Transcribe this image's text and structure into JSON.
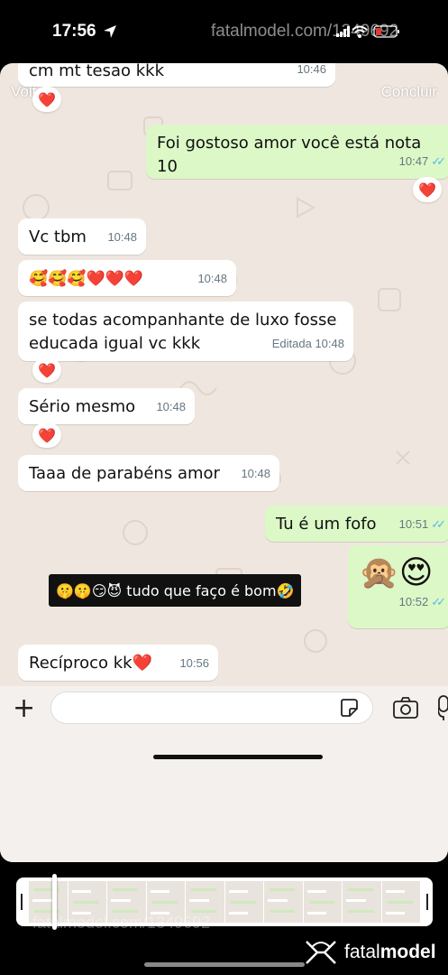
{
  "status": {
    "time": "17:56",
    "watermark": "fatalmodel.com/1349692"
  },
  "nav": {
    "back_label": "Voltar",
    "done_label": "Concluir"
  },
  "messages": [
    {
      "id": "m0",
      "dir": "in",
      "text": "cm mt tesao kkk",
      "time": "10:46",
      "reaction": "❤️"
    },
    {
      "id": "m1",
      "dir": "out",
      "text": "Foi gostoso amor você está nota 10",
      "time": "10:47",
      "reaction": "❤️"
    },
    {
      "id": "m2",
      "dir": "in",
      "text": "Vc tbm",
      "time": "10:48"
    },
    {
      "id": "m3",
      "dir": "in",
      "text": "🥰🥰🥰❤️❤️❤️",
      "time": "10:48"
    },
    {
      "id": "m4",
      "dir": "in",
      "text": "se todas acompanhante de luxo fosse educada igual vc kkk",
      "time": "10:48",
      "edited_label": "Editada",
      "reaction": "❤️"
    },
    {
      "id": "m5",
      "dir": "in",
      "text": "Sério mesmo",
      "time": "10:48",
      "reaction": "❤️"
    },
    {
      "id": "m6",
      "dir": "in",
      "text": "Taaa de parabéns amor",
      "time": "10:48"
    },
    {
      "id": "m7",
      "dir": "out",
      "text": "Tu é um fofo",
      "time": "10:51"
    },
    {
      "id": "m8",
      "dir": "out",
      "text": "🙊😍",
      "time": "10:52"
    },
    {
      "id": "m9",
      "dir": "in",
      "text": "Recíproco kk❤️",
      "time": "10:56"
    }
  ],
  "sticker_caption": "🤫🤫😏😈 tudo que faço é bom🤣",
  "composer": {
    "placeholder": ""
  },
  "footer": {
    "watermark": "fatalmodel.com/1349692",
    "brand_light": "fatal",
    "brand_bold": "model"
  },
  "colors": {
    "chat_bg": "#efe7df",
    "incoming": "#ffffff",
    "outgoing": "#dcf8c6",
    "read_ticks": "#53bdeb",
    "reaction_heart": "#e0243a"
  },
  "icons": [
    "location-arrow-icon",
    "signal-icon",
    "wifi-icon",
    "battery-icon",
    "plus-icon",
    "sticker-icon",
    "camera-icon",
    "microphone-icon",
    "fatalmodel-logo"
  ]
}
